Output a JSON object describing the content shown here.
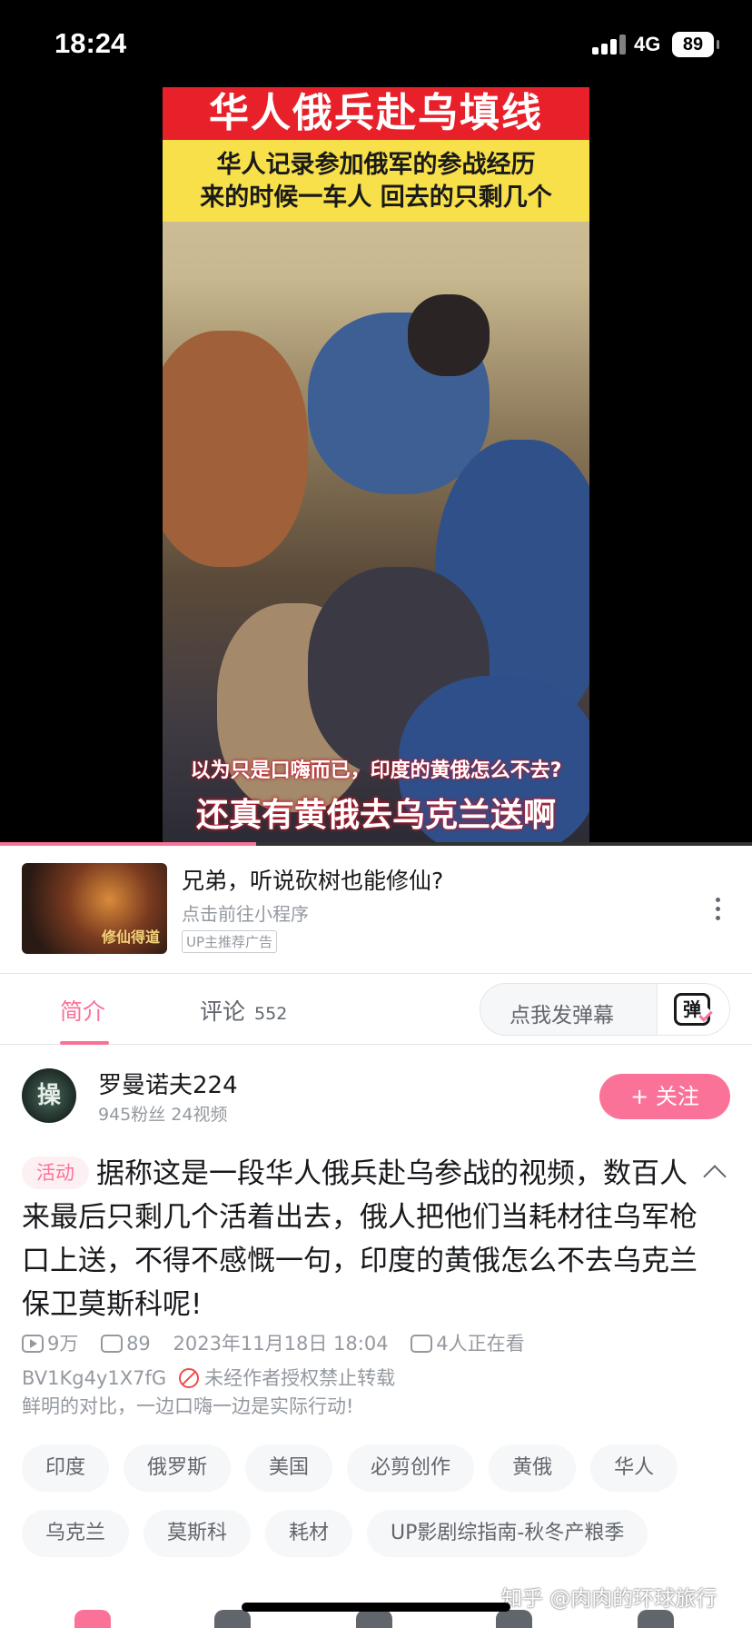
{
  "status_bar": {
    "time": "18:24",
    "network": "4G",
    "battery": "89"
  },
  "video": {
    "title_band": "华人俄兵赴乌填线",
    "subtitle_line1": "华人记录参加俄军的参战经历",
    "subtitle_line2": "来的时候一车人 回去的只剩几个",
    "caption_small": "以为只是口嗨而已，印度的黄俄怎么不去?",
    "caption_big": "还真有黄俄去乌克兰送啊",
    "progress_fraction": 0.34
  },
  "ad": {
    "thumb_text": "修仙得道",
    "title": "兄弟，听说砍树也能修仙?",
    "subtitle": "点击前往小程序",
    "tag": "UP主推荐广告"
  },
  "tabs": {
    "intro": "简介",
    "comments": "评论",
    "comment_count": "552",
    "danmaku_placeholder": "点我发弹幕",
    "danmaku_icon_char": "弹"
  },
  "uploader": {
    "avatar_char": "操",
    "name": "罗曼诺夫224",
    "stats": "945粉丝  24视频",
    "follow_label": "+ 关注"
  },
  "description": {
    "badge": "活动",
    "text": "据称这是一段华人俄兵赴乌参战的视频，数百人来最后只剩几个活着出去，俄人把他们当耗材往乌军枪口上送，不得不感慨一句，印度的黄俄怎么不去乌克兰保卫莫斯科呢!"
  },
  "meta": {
    "views": "9万",
    "danmaku_count": "89",
    "date": "2023年11月18日 18:04",
    "watching": "4人正在看",
    "bvid": "BV1Kg4y1X7fG",
    "repost_notice": "未经作者授权禁止转载",
    "tagline": "鲜明的对比，一边口嗨一边是实际行动!"
  },
  "tags": [
    "印度",
    "俄罗斯",
    "美国",
    "必剪创作",
    "黄俄",
    "华人",
    "乌克兰",
    "莫斯科",
    "耗材",
    "UP影剧综指南-秋冬产粮季"
  ],
  "watermark": "知乎 @肉肉的环球旅行",
  "colors": {
    "accent": "#fb7299",
    "text": "#18191c",
    "muted": "#9499a0",
    "warning": "#f04c49"
  }
}
